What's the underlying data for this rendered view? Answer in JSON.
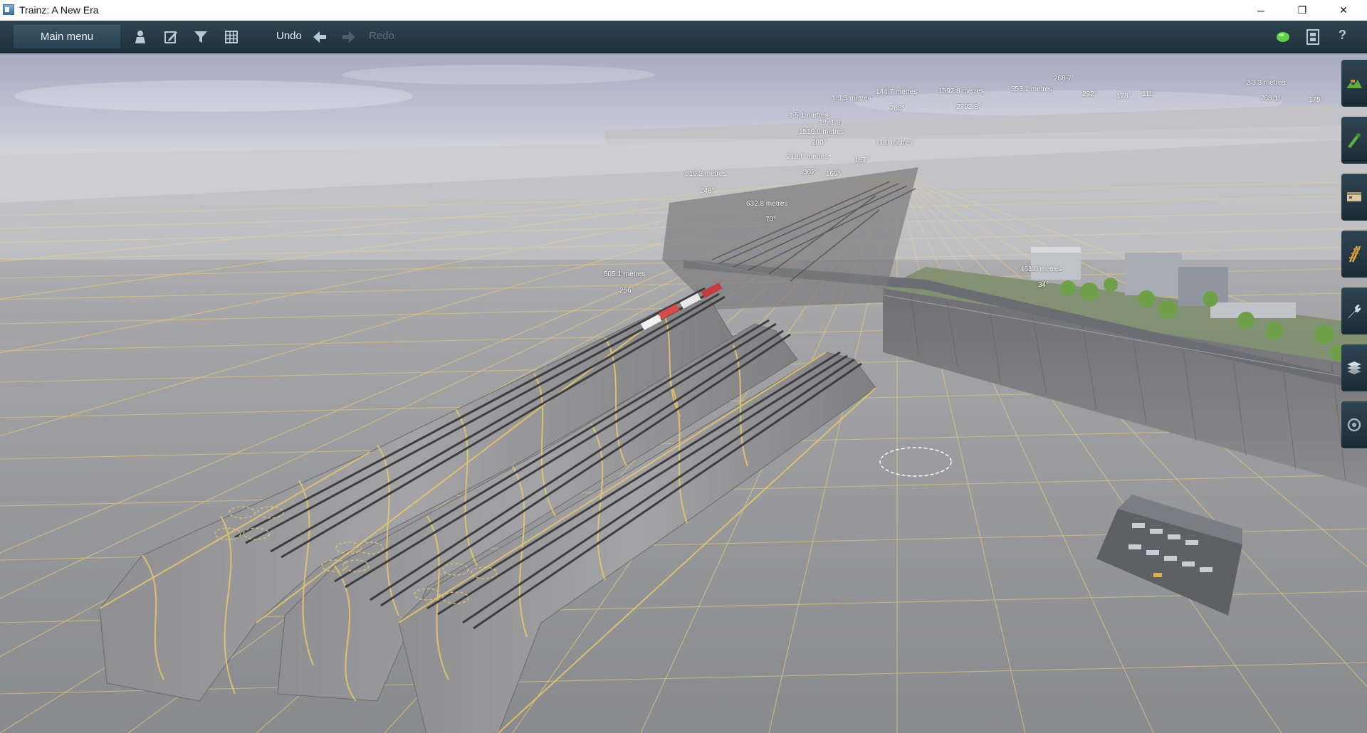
{
  "window": {
    "title": "Trainz: A New Era",
    "controls": [
      "─",
      "❐",
      "✕"
    ]
  },
  "toolbar": {
    "main_menu": "Main menu",
    "undo": "Undo",
    "redo": "Redo",
    "tools": [
      "person-icon",
      "edit-icon",
      "filter-icon",
      "grid-icon"
    ],
    "right_tools": [
      "online-status-icon",
      "filmstrip-icon",
      "help-icon"
    ],
    "help_label": "?"
  },
  "viewport": {
    "measurements": {
      "m1": "819.2 metres",
      "m2": "248°",
      "m3": "632.8 metres",
      "m4": "70°",
      "m5": "505.1 metres",
      "m6": "256°",
      "m7": "461.0 metres",
      "m8": "34°",
      "m9": "1516.0 metres",
      "m10": "260°",
      "m11": "218.0 metres",
      "m12": "362°",
      "m13": "169°",
      "m14": "167°",
      "m15": "1.5.1 metres",
      "m16": "1.5.1.9",
      "m17": "144.7 metres",
      "m18": "1392.8 metres",
      "m19": "2792.8°",
      "m20": "1.3.3 metres",
      "m21": "288°",
      "m22": "11.8 metres",
      "m23": "353.1 metres",
      "m24": "268.7°",
      "m25": "292°",
      "m26": "178°",
      "m27": "111°",
      "m28": "2.3.3 metres",
      "m29": "268.1°",
      "m30": "175°"
    }
  },
  "side_panel": {
    "buttons": [
      "terrain-icon",
      "paint-icon",
      "objects-icon",
      "track-icon",
      "tools-icon",
      "layers-icon",
      "settings-icon"
    ]
  },
  "colors": {
    "toolbar": "#1f313c",
    "grid_line": "#e8c86a",
    "terrain": "#8d8d90",
    "sky_top": "#a9adc4"
  }
}
